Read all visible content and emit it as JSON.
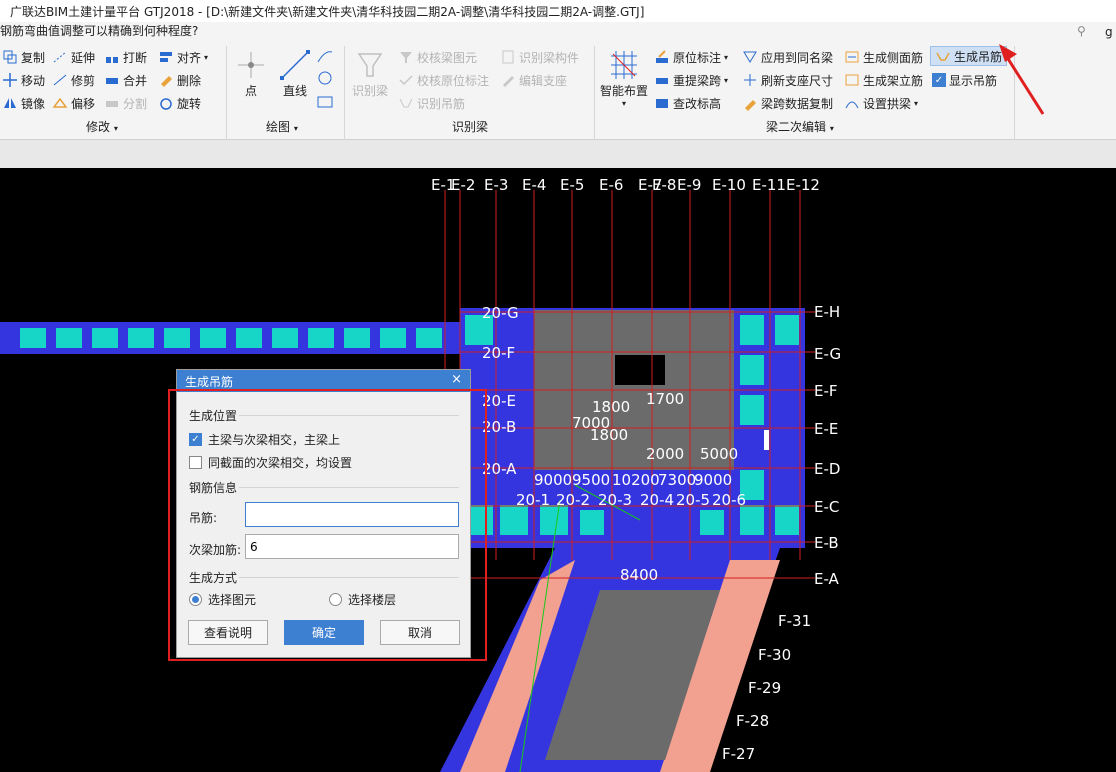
{
  "window": {
    "title": "广联达BIM土建计量平台 GTJ2018 - [D:\\新建文件夹\\新建文件夹\\清华科技园二期2A-调整\\清华科技园二期2A-调整.GTJ]",
    "search_placeholder": "钢筋弯曲值调整可以精确到何种程度?",
    "right_char": "g"
  },
  "ribbon": {
    "modify": {
      "label": "修改",
      "items": [
        "复制",
        "延伸",
        "打断",
        "对齐",
        "移动",
        "修剪",
        "合并",
        "删除",
        "镜像",
        "偏移",
        "分割",
        "旋转"
      ]
    },
    "draw": {
      "label": "绘图",
      "point": "点",
      "line": "直线"
    },
    "recognize": {
      "label": "识别梁",
      "big": "识别梁",
      "items": [
        "校核梁图元",
        "识别梁构件",
        "校核原位标注",
        "编辑支座",
        "识别吊筋"
      ]
    },
    "secondary": {
      "label": "梁二次编辑",
      "big": "智能布置",
      "items": [
        "原位标注",
        "应用到同名梁",
        "生成侧面筋",
        "生成吊筋",
        "重提梁跨",
        "刷新支座尺寸",
        "生成架立筋",
        "显示吊筋",
        "查改标高",
        "梁跨数据复制",
        "设置拱梁"
      ]
    }
  },
  "canvas": {
    "axis_top": [
      "E-1",
      "E-2",
      "E-3",
      "E-4",
      "E-5",
      "E-6",
      "E-7",
      "E-8",
      "E-9",
      "E-10",
      "E-11",
      "E-12"
    ],
    "axis_right": [
      "E-H",
      "E-G",
      "E-F",
      "E-E",
      "E-D",
      "E-C",
      "E-B",
      "E-A"
    ],
    "axis_left": [
      "20-G",
      "20-F",
      "20-E",
      "20-B",
      "20-A"
    ],
    "axis_mid": [
      "20-1",
      "20-2",
      "20-3",
      "20-4",
      "20-5",
      "20-6"
    ],
    "axis_lower": [
      "F-31",
      "F-30",
      "F-29",
      "F-28",
      "F-27"
    ],
    "dims": [
      "9000",
      "9500",
      "10200",
      "7300",
      "9000",
      "1800",
      "7000",
      "1800",
      "1700",
      "2000",
      "5000",
      "8400"
    ]
  },
  "dialog": {
    "title": "生成吊筋",
    "close": "×",
    "section_position": "生成位置",
    "opt1": "主梁与次梁相交，主梁上",
    "opt1_checked": true,
    "opt2": "同截面的次梁相交，均设置",
    "opt2_checked": false,
    "section_rebar": "钢筋信息",
    "hanger_label": "吊筋:",
    "hanger_value": "",
    "secondary_label": "次梁加筋:",
    "secondary_value": "6",
    "section_mode": "生成方式",
    "radio1": "选择图元",
    "radio2": "选择楼层",
    "btn_help": "查看说明",
    "btn_ok": "确定",
    "btn_cancel": "取消"
  },
  "colors": {
    "accent": "#3d7fd1",
    "highlight_red": "#e02020",
    "beam_blue": "#3535e0",
    "column_cyan": "#17d6c8",
    "slab_gray": "#6b6b6b",
    "axis_green": "#19c819"
  }
}
